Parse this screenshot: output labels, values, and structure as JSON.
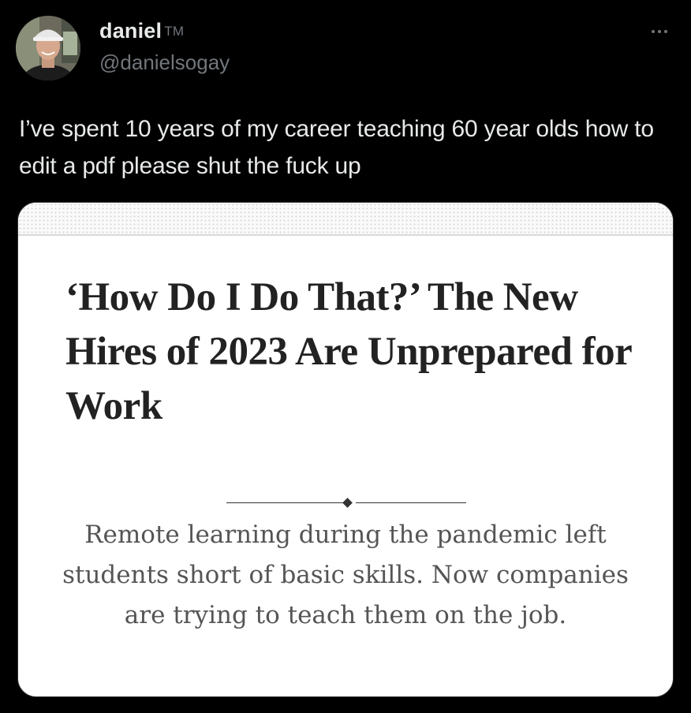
{
  "tweet": {
    "author": {
      "display_name": "daniel",
      "name_suffix": "TM",
      "handle": "@danielsogay"
    },
    "text": "I’ve spent 10 years of my career teaching 60 year olds how to edit a pdf please shut the fuck up",
    "more_icon": "ellipsis-horizontal-icon"
  },
  "card": {
    "headline": "‘How Do I Do That?’ The New Hires of 2023 Are Unprepared for Work",
    "dek": "Remote learning during the pandemic left students short of basic skills. Now companies are trying to teach them on the job."
  },
  "colors": {
    "background": "#000000",
    "text_primary": "#e7e9ea",
    "text_secondary": "#71767b",
    "card_background": "#ffffff",
    "headline": "#222222",
    "dek": "#555555"
  }
}
